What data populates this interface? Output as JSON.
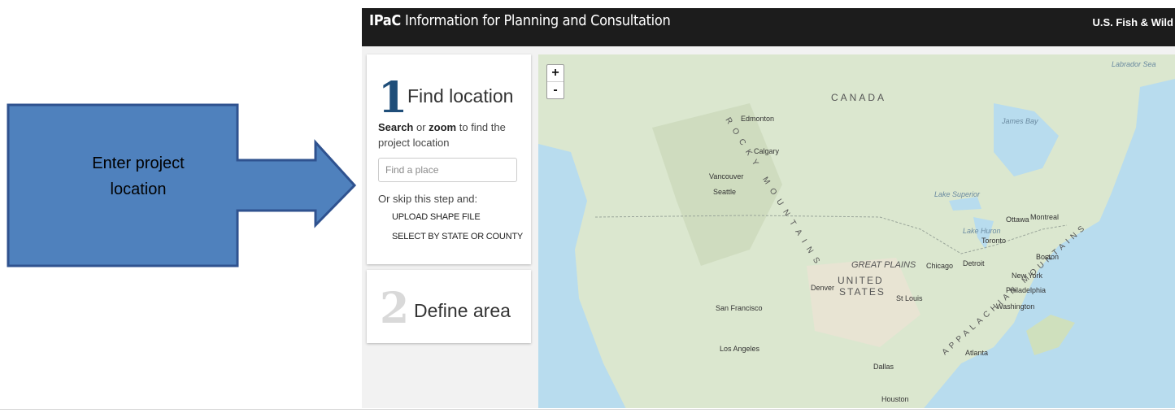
{
  "callout": {
    "line1": "Enter project",
    "line2": "location",
    "fill": "#4f81bd",
    "stroke": "#2f528f"
  },
  "header": {
    "brand": "IPaC",
    "title": "Information for Planning and Consultation",
    "agency": "U.S. Fish & Wild"
  },
  "step1": {
    "number": "1",
    "title": "Find location",
    "hint_bold1": "Search",
    "hint_mid": " or ",
    "hint_bold2": "zoom",
    "hint_rest": " to find the project location",
    "search_placeholder": "Find a place",
    "skip_text": "Or skip this step and:",
    "upload_link": "UPLOAD SHAPE FILE",
    "state_link": "SELECT BY STATE OR COUNTY"
  },
  "step2": {
    "number": "2",
    "title": "Define area"
  },
  "map": {
    "zoom_in": "+",
    "zoom_out": "-",
    "labels": {
      "canada": "CANADA",
      "rocky_mountains": "ROCKY MOUNTAINS",
      "great_plains": "GREAT PLAINS",
      "united": "UNITED",
      "states": "STATES",
      "appalachian": "APPALACHIAN MOUNTAINS",
      "james_bay": "James Bay",
      "lake_superior": "Lake Superior",
      "lake_huron": "Lake Huron",
      "labrador_sea": "Labrador Sea"
    },
    "cities": [
      "Edmonton",
      "Calgary",
      "Vancouver",
      "Seattle",
      "Ottawa",
      "Montreal",
      "Toronto",
      "Boston",
      "Chicago",
      "Detroit",
      "New York",
      "Philadelphia",
      "Washington",
      "Denver",
      "St Louis",
      "San Francisco",
      "Los Angeles",
      "Atlanta",
      "Dallas",
      "Houston"
    ]
  }
}
